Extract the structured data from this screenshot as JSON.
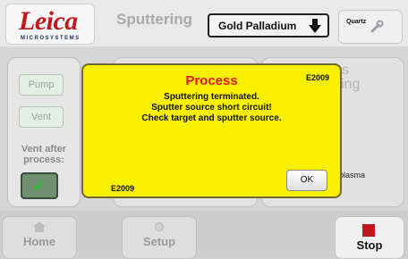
{
  "header": {
    "brand": "Leica",
    "brand_sub": "MICROSYSTEMS",
    "title": "Sputtering",
    "target_select": {
      "value": "Gold Palladium"
    },
    "quartz_label": "Quartz"
  },
  "left_panel": {
    "pump_label": "Pump",
    "vent_label": "Vent",
    "vent_after_line1": "Vent after",
    "vent_after_line2": "process:"
  },
  "right_panel": {
    "ghost_line1": "us",
    "ghost_line2": "sing",
    "plasma_label": "plasma"
  },
  "bottom_nav": {
    "home_label": "Home",
    "setup_label": "Setup",
    "stop_label": "Stop"
  },
  "modal": {
    "title": "Process",
    "code_top": "E2009",
    "message_line1": "Sputtering terminated.",
    "message_line2": "Sputter source short circuit!",
    "message_line3": "Check target and sputter source.",
    "code_bottom": "E2009",
    "ok_label": "OK"
  },
  "colors": {
    "brand_red": "#c0181f",
    "modal_yellow": "#f9f000",
    "modal_title_red": "#e01818"
  }
}
